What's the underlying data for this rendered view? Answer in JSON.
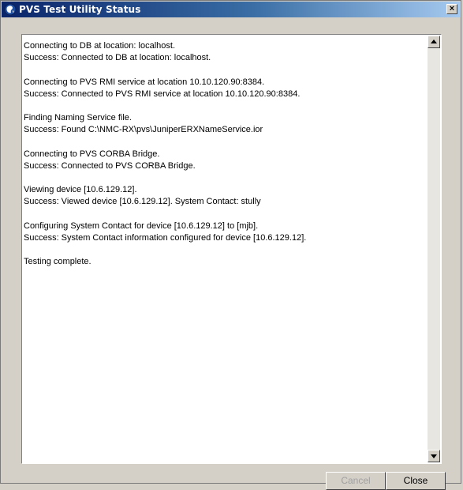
{
  "window": {
    "title": "PVS Test Utility Status",
    "close_glyph": "×"
  },
  "log": {
    "lines": [
      "Connecting to DB at location: localhost.",
      "Success: Connected to DB at location: localhost.",
      "",
      "Connecting to PVS RMI service at location 10.10.120.90:8384.",
      "Success: Connected to PVS RMI service at location 10.10.120.90:8384.",
      "",
      "Finding Naming Service file.",
      "Success: Found C:\\NMC-RX\\pvs\\JuniperERXNameService.ior",
      "",
      "Connecting to PVS CORBA Bridge.",
      "Success: Connected to PVS CORBA Bridge.",
      "",
      "Viewing device [10.6.129.12].",
      "Success: Viewed device [10.6.129.12]. System Contact: stully",
      "",
      "Configuring System Contact for device [10.6.129.12] to [mjb].",
      "Success: System Contact information configured for device [10.6.129.12].",
      "",
      "Testing complete."
    ]
  },
  "buttons": {
    "cancel_label": "Cancel",
    "close_label": "Close"
  },
  "icons": {
    "app": "globe-icon",
    "scroll_up": "scroll-up-arrow-icon",
    "scroll_down": "scroll-down-arrow-icon"
  }
}
